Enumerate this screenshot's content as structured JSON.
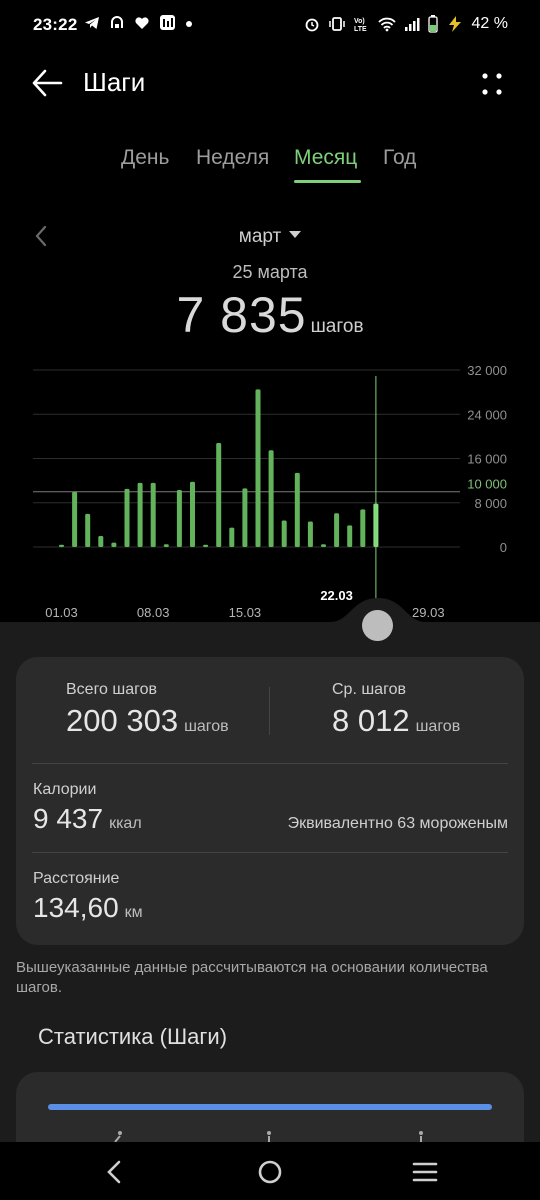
{
  "status": {
    "time": "23:22",
    "battery": "42 %",
    "left_icons": [
      "telegram-icon",
      "notification-icon",
      "heart-icon",
      "app-icon",
      "dot-icon"
    ],
    "right_icons": [
      "alarm-icon",
      "vibrate-icon",
      "volte-icon",
      "wifi-icon",
      "signal-icon",
      "battery-icon",
      "charging-icon"
    ]
  },
  "app": {
    "title": "Шаги"
  },
  "tabs": [
    {
      "label": "День"
    },
    {
      "label": "Неделя"
    },
    {
      "label": "Месяц",
      "active": true
    },
    {
      "label": "Год"
    }
  ],
  "month": {
    "label": "март",
    "selected_date": "25 марта",
    "selected_steps": "7 835",
    "steps_unit": "шагов"
  },
  "chart_data": {
    "type": "bar",
    "x": [
      "01.03",
      "02.03",
      "03.03",
      "04.03",
      "05.03",
      "06.03",
      "07.03",
      "08.03",
      "09.03",
      "10.03",
      "11.03",
      "12.03",
      "13.03",
      "14.03",
      "15.03",
      "16.03",
      "17.03",
      "18.03",
      "19.03",
      "20.03",
      "21.03",
      "22.03",
      "23.03",
      "24.03",
      "25.03"
    ],
    "values": [
      400,
      10000,
      6000,
      2000,
      800,
      10500,
      11600,
      11600,
      500,
      10300,
      11800,
      400,
      18800,
      3500,
      10600,
      28500,
      17500,
      4800,
      13400,
      4600,
      500,
      6100,
      3900,
      6800,
      7835
    ],
    "selected_index": 24,
    "ylim": [
      0,
      32000
    ],
    "y_ticks": [
      "32 000",
      "24 000",
      "16 000",
      "8 000",
      "0"
    ],
    "goal_label": "10 000",
    "goal_value": 10000,
    "x_tick_labels": [
      {
        "label": "01.03",
        "index": 0
      },
      {
        "label": "08.03",
        "index": 7
      },
      {
        "label": "15.03",
        "index": 14
      },
      {
        "label": "22.03",
        "index": 21,
        "highlight": true
      },
      {
        "label": "29.03",
        "index": 28
      }
    ],
    "bar_color": "#62b35c",
    "selected_color": "#86e07e",
    "grid": true
  },
  "summary": {
    "total_label": "Всего шагов",
    "total_value": "200 303",
    "total_unit": "шагов",
    "avg_label": "Ср. шагов",
    "avg_value": "8 012",
    "avg_unit": "шагов",
    "calories_label": "Калории",
    "calories_value": "9 437",
    "calories_unit": "ккал",
    "calories_equiv": "Эквивалентно 63 мороженым",
    "distance_label": "Расстояние",
    "distance_value": "134,60",
    "distance_unit": "км"
  },
  "footnote": "Вышеуказанные данные рассчитываются на основании количества шагов.",
  "stats": {
    "title": "Статистика (Шаги)",
    "bar_color": "#5b8fe6"
  },
  "colors": {
    "accent": "#7ed07a",
    "background": "#000000",
    "card": "#2b2b2b"
  }
}
